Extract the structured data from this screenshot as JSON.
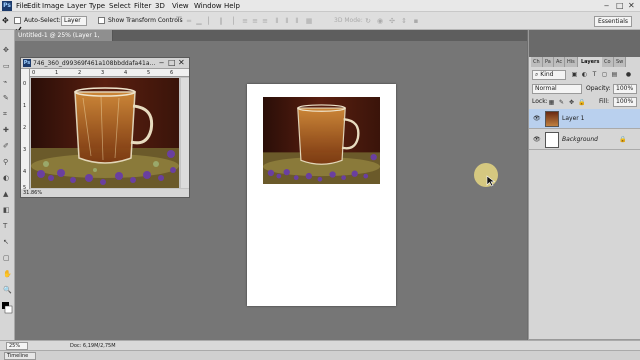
{
  "app": {
    "logo": "Ps"
  },
  "menu": [
    "File",
    "Edit",
    "Image",
    "Layer",
    "Type",
    "Select",
    "Filter",
    "3D",
    "View",
    "Window",
    "Help"
  ],
  "window_controls": {
    "minimize": "‒",
    "maximize": "□",
    "close": "✕"
  },
  "options": {
    "auto_select_label": "Auto-Select:",
    "auto_select_checked": true,
    "auto_select_target": "Layer",
    "show_transform_label": "Show Transform Controls",
    "show_transform_checked": false,
    "mode_3d_label": "3D Mode:",
    "workspace": "Essentials"
  },
  "document_tab": {
    "label": "Untitled-1 @ 25% (Layer 1, RGB/8) *"
  },
  "floating_window": {
    "title": "746_360_d99369f461a108bbddafa41a...",
    "ruler_top": [
      "0",
      "1",
      "2",
      "3",
      "4",
      "5",
      "6"
    ],
    "ruler_left": [
      "0",
      "1",
      "2",
      "3",
      "4",
      "5"
    ],
    "zoom": "31.86%"
  },
  "layers_panel": {
    "tabs": [
      "Ch",
      "Pa",
      "Ac",
      "His",
      "Layers",
      "Co",
      "Sw"
    ],
    "active_tab": "Layers",
    "kind_label": "Kind",
    "blend_mode": "Normal",
    "opacity_label": "Opacity:",
    "opacity_value": "100%",
    "lock_label": "Lock:",
    "fill_label": "Fill:",
    "fill_value": "100%",
    "layers": [
      {
        "name": "Layer 1",
        "selected": true
      },
      {
        "name": "Background",
        "selected": false,
        "locked": true
      }
    ]
  },
  "status": {
    "zoom": "25%",
    "doc": "Doc: 6,19M/2,75M"
  },
  "timeline": {
    "label": "Timeline"
  },
  "colors": {
    "selected_layer": "#b9d0ee",
    "canvas_bg": "#767676"
  }
}
